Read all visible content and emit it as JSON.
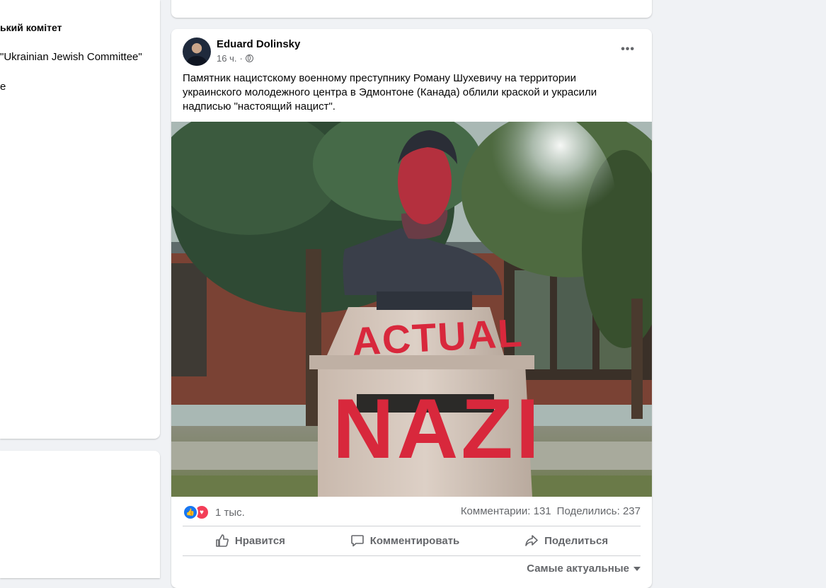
{
  "left_panel": {
    "title": "ький комітет",
    "line1": "\"Ukrainian Jewish Committee\"",
    "line2": "e"
  },
  "post": {
    "author": "Eduard Dolinsky",
    "time": "16 ч.",
    "separator": "·",
    "text": "Памятник нацистскому военному преступнику Роману Шухевичу на территории украинского молодежного центра в Эдмонтоне (Канада) облили краской и украсили надписью \"настоящий нацист\".",
    "photo_graffiti": [
      "ACTUAL",
      "NAZI"
    ],
    "reaction_count": "1 тыс.",
    "comments": "Комментарии: 131",
    "shares": "Поделились: 237",
    "actions": {
      "like": "Нравится",
      "comment": "Комментировать",
      "share": "Поделиться"
    },
    "sort_label": "Самые актуальные"
  },
  "colors": {
    "like_blue": "#1877f2",
    "love_red": "#f33e58",
    "secondary_text": "#65676b",
    "background": "#f0f2f5"
  },
  "icons": [
    "like-icon",
    "love-icon",
    "globe-icon",
    "more-icon",
    "thumbs-up-icon",
    "comment-icon",
    "share-icon",
    "caret-down-icon"
  ]
}
